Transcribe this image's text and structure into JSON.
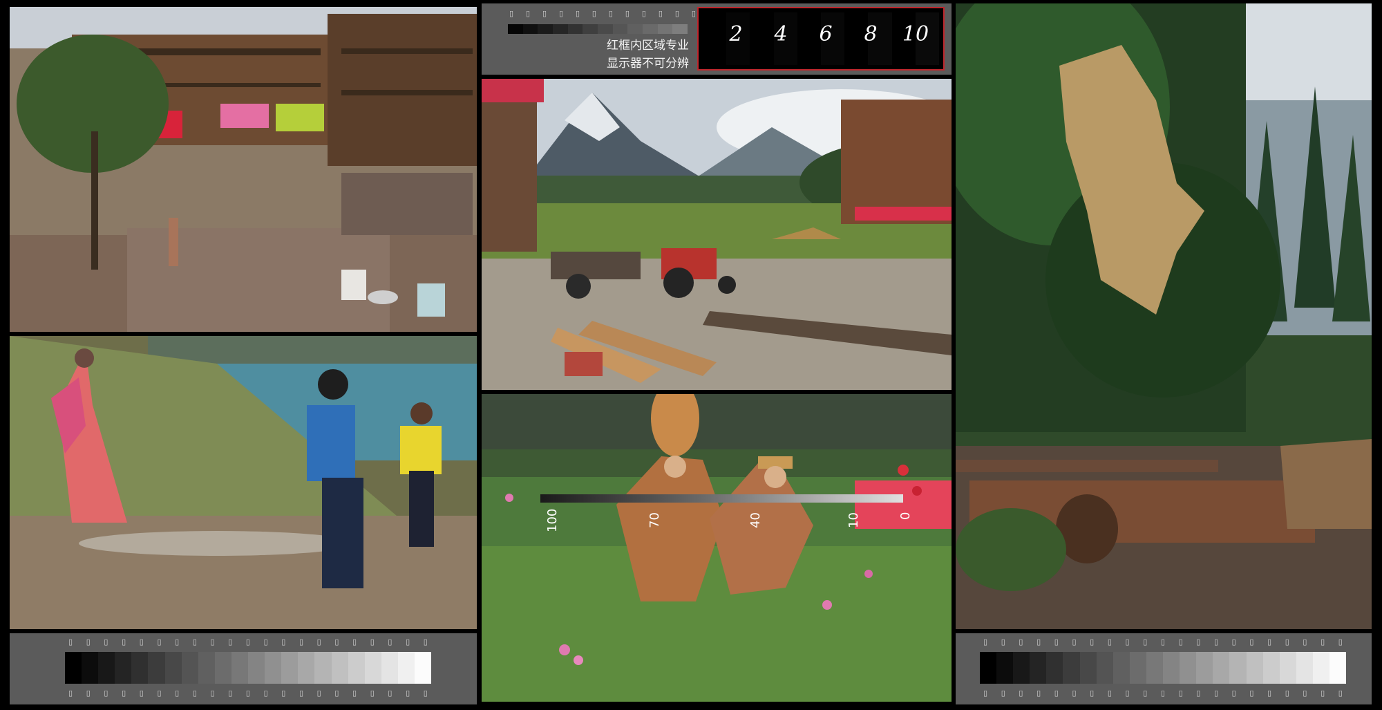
{
  "top_panel": {
    "chinese_line1": "红框内区域专业",
    "chinese_line2": "显示器不可分辨",
    "scale_labels": [
      "2",
      "4",
      "6",
      "8",
      "10"
    ]
  },
  "meter": {
    "ticks": [
      "100",
      "70",
      "40",
      "10",
      "0"
    ]
  },
  "photos": [
    {
      "name": "village-courtyard-photo"
    },
    {
      "name": "mountain-valley-tractor-photo"
    },
    {
      "name": "hay-tree-log-photo"
    },
    {
      "name": "hillside-lake-people-photo"
    },
    {
      "name": "costumed-pair-flowers-photo"
    }
  ],
  "colors": {
    "background": "#000000",
    "panel": "#5b5b5b",
    "red_frame": "#c0262c"
  }
}
